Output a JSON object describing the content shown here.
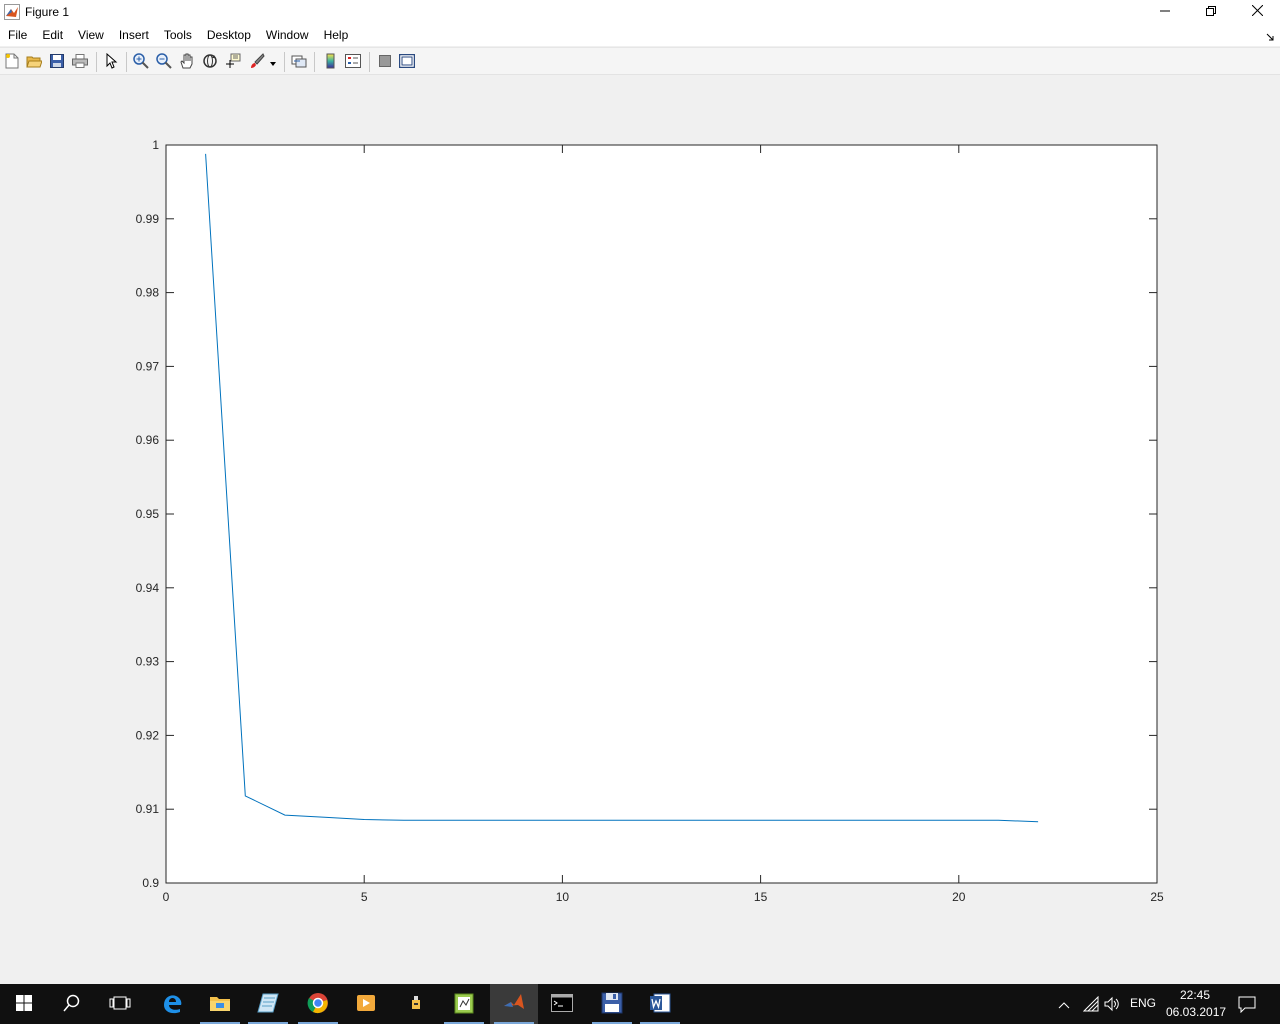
{
  "window": {
    "title": "Figure 1",
    "icons": [
      "matlab-icon",
      "minimize-icon",
      "maximize-icon",
      "close-icon"
    ]
  },
  "menu": {
    "items": [
      "File",
      "Edit",
      "View",
      "Insert",
      "Tools",
      "Desktop",
      "Window",
      "Help"
    ]
  },
  "toolbar": {
    "buttons": [
      "new-figure",
      "open-file",
      "save",
      "print",
      "edit-plot",
      "zoom-in",
      "zoom-out",
      "pan",
      "rotate-3d",
      "data-cursor",
      "brush",
      "link-plot",
      "colorbar",
      "legend",
      "hide-plot-tools",
      "show-plot-tools"
    ]
  },
  "chart_data": {
    "type": "line",
    "title": "",
    "xlabel": "",
    "ylabel": "",
    "xlim": [
      0,
      25
    ],
    "ylim": [
      0.9,
      1.0
    ],
    "x_ticks": [
      "0",
      "5",
      "10",
      "15",
      "20",
      "25"
    ],
    "y_ticks": [
      "0.9",
      "0.91",
      "0.92",
      "0.93",
      "0.94",
      "0.95",
      "0.96",
      "0.97",
      "0.98",
      "0.99",
      "1"
    ],
    "grid": false,
    "line_color": "#0072bd",
    "series": [
      {
        "x": [
          1,
          2,
          3,
          4,
          5,
          6,
          7,
          8,
          9,
          10,
          11,
          12,
          13,
          14,
          15,
          16,
          17,
          18,
          19,
          20,
          21,
          22
        ],
        "values": [
          0.9988,
          0.9118,
          0.9092,
          0.9089,
          0.9086,
          0.9085,
          0.9085,
          0.9085,
          0.9085,
          0.9085,
          0.9085,
          0.9085,
          0.9085,
          0.9085,
          0.9085,
          0.9085,
          0.9085,
          0.9085,
          0.9085,
          0.9085,
          0.9085,
          0.9083
        ]
      }
    ]
  },
  "taskbar": {
    "apps": [
      "start",
      "search",
      "task-view",
      "edge",
      "file-explorer",
      "notes",
      "chrome",
      "media-player",
      "usb-tool",
      "notepad-plus",
      "matlab",
      "cmd",
      "floppy-app",
      "word"
    ],
    "active_app": "matlab",
    "language": "ENG",
    "time": "22:45",
    "date": "06.03.2017"
  }
}
